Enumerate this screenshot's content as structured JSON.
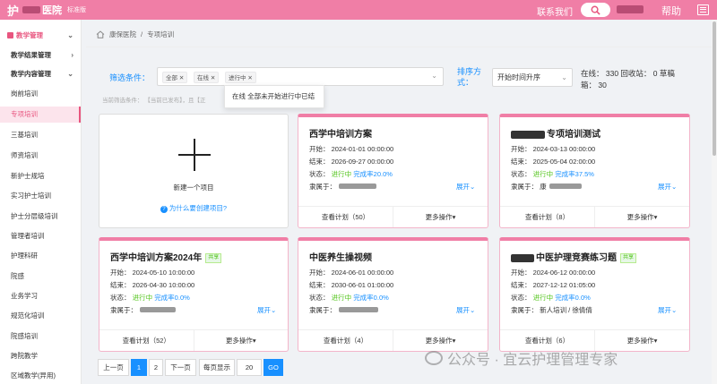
{
  "topbar": {
    "logo_char": "护",
    "logo_suffix": "医院",
    "version": "标准版",
    "contact": "联系我们",
    "help": "帮助",
    "brand_color": "#f07ea6"
  },
  "sidebar": {
    "items": [
      {
        "label": "教学管理",
        "type": "top"
      },
      {
        "label": "教学结果管理",
        "type": "group"
      },
      {
        "label": "教学内容管理",
        "type": "group"
      },
      {
        "label": "岗前培训",
        "type": "item"
      },
      {
        "label": "专项培训",
        "type": "active"
      },
      {
        "label": "三基培训",
        "type": "item"
      },
      {
        "label": "师资培训",
        "type": "item"
      },
      {
        "label": "新护士规培",
        "type": "item"
      },
      {
        "label": "实习护士培训",
        "type": "item"
      },
      {
        "label": "护士分层级培训",
        "type": "item"
      },
      {
        "label": "管理者培训",
        "type": "item"
      },
      {
        "label": "护理科研",
        "type": "item"
      },
      {
        "label": "院感",
        "type": "item"
      },
      {
        "label": "业务学习",
        "type": "item"
      },
      {
        "label": "规范化培训",
        "type": "item"
      },
      {
        "label": "院感培训",
        "type": "item"
      },
      {
        "label": "跨院教学",
        "type": "item"
      },
      {
        "label": "区域教学(异用)",
        "type": "item"
      }
    ]
  },
  "breadcrumb": {
    "home_icon": "home-icon",
    "items": [
      "康保医院",
      "专项培训"
    ]
  },
  "filter": {
    "label": "筛选条件：",
    "tags": [
      "全部",
      "在线",
      "进行中"
    ],
    "dropdown_text": "在线 全部未开始进行中已结",
    "current": "当前筛选条件：  【当前已发布】，且【正"
  },
  "sort": {
    "label": "排序方式：",
    "value": "开始时间升序"
  },
  "stats": {
    "line1": "在线： 330   回收站： 0   草稿",
    "line2": "箱： 30"
  },
  "new_card": {
    "label": "新建一个项目",
    "help": "为什么要创建项目?"
  },
  "cards": [
    {
      "title": "西学中培训方案",
      "share": "",
      "start": "开始： 2024-01-01 00:00:00",
      "end": "结束： 2026-09-27 00:00:00",
      "status": "进行中",
      "rate": "完成率20.0%",
      "owner": "隶属于：",
      "expand": "展开",
      "plan": "查看计划（50）",
      "more": "更多操作"
    },
    {
      "title": "专项培训测试",
      "share": "",
      "start": "开始： 2024-03-13 00:00:00",
      "end": "结束： 2025-05-04 02:00:00",
      "status": "进行中",
      "rate": "完成率37.5%",
      "owner": "隶属于： 康",
      "expand": "展开",
      "plan": "查看计划（8）",
      "more": "更多操作"
    },
    {
      "title": "西学中培训方案2024年",
      "share": "共享",
      "start": "开始： 2024-05-10 10:00:00",
      "end": "结束： 2026-04-30 10:00:00",
      "status": "进行中",
      "rate": "完成率0.0%",
      "owner": "隶属于：",
      "expand": "展开",
      "plan": "查看计划（52）",
      "more": "更多操作"
    },
    {
      "title": "中医养生操视频",
      "share": "",
      "start": "开始： 2024-06-01 00:00:00",
      "end": "结束： 2030-06-01 01:00:00",
      "status": "进行中",
      "rate": "完成率0.0%",
      "owner": "隶属于：",
      "expand": "展开",
      "plan": "查看计划（4）",
      "more": "更多操作"
    },
    {
      "title": "中医护理竞赛练习题",
      "share": "共享",
      "start": "开始： 2024-06-12 00:00:00",
      "end": "结束： 2027-12-12 01:05:00",
      "status": "进行中",
      "rate": "完成率0.0%",
      "owner": "隶属于： 新人培训 / 徐倩倩",
      "expand": "展开",
      "plan": "查看计划（6）",
      "more": "更多操作"
    }
  ],
  "pagination": {
    "prev": "上一页",
    "pages": [
      "1",
      "2"
    ],
    "next": "下一页",
    "per_page_label": "每页显示",
    "per_page": "20",
    "go": "GO"
  },
  "watermark": "公众号 · 宜云护理管理专家"
}
